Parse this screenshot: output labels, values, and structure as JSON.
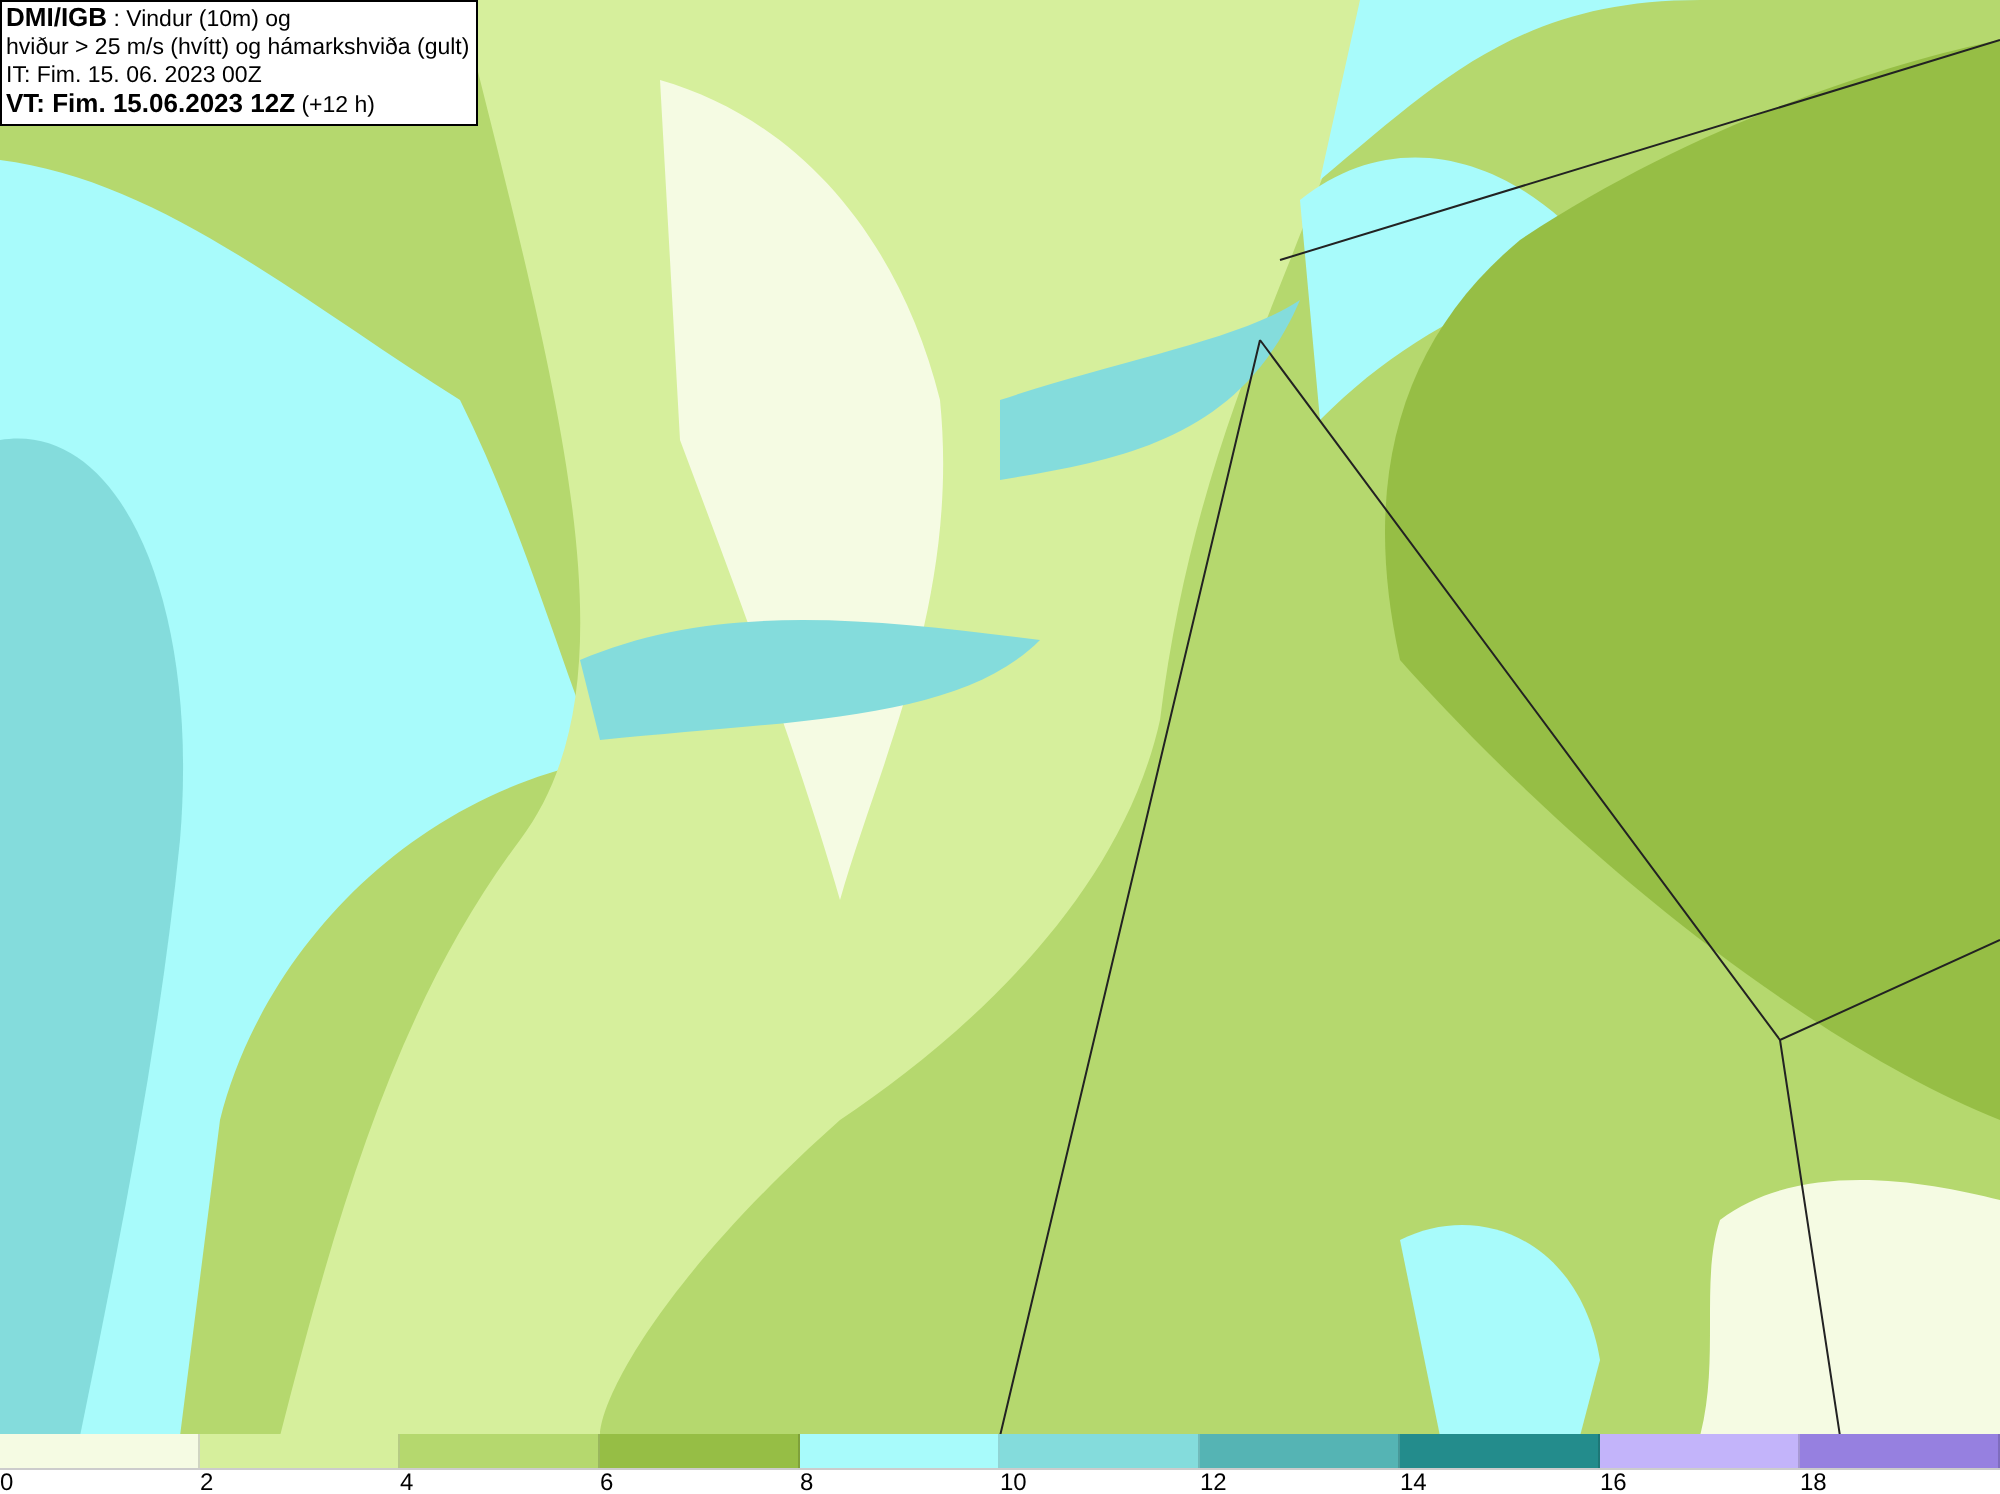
{
  "header": {
    "lines": [
      "**DMI/IGB** : Vindur (10m) og",
      "hviður > 25 m/s (hvítt) og hámarkshviða (gult)",
      "IT: Fim. 15. 06. 2023 00Z",
      "**VT: Fim. 15.06.2023 12Z** (+12 h)"
    ]
  },
  "legend": {
    "bins": [
      {
        "color": "#f5fbe3"
      },
      {
        "color": "#d6ef9c"
      },
      {
        "color": "#b5d86e"
      },
      {
        "color": "#96be45"
      },
      {
        "color": "#a8fbfb"
      },
      {
        "color": "#84dcdc"
      },
      {
        "color": "#55b4b4"
      },
      {
        "color": "#238c8c"
      },
      {
        "color": "#c3b4fa"
      },
      {
        "color": "#9680e0"
      }
    ],
    "ticks": [
      "0",
      "2",
      "4",
      "6",
      "8",
      "10",
      "12",
      "14",
      "16",
      "18"
    ]
  }
}
